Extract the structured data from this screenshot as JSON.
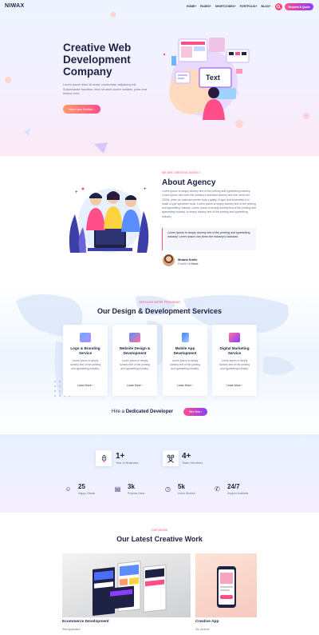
{
  "header": {
    "logo": "NIWAX",
    "nav": [
      "HOME+",
      "PAGES+",
      "SHORTCODES+",
      "PORTFOLIO+",
      "BLOG+"
    ],
    "quote_label": "Request A Quote"
  },
  "hero": {
    "title": "Creative Web Development Company",
    "text": "Lorem ipsum dolor sit amet, consectetur adipiscing elit. Suspendisse faucibus, risus sit amet auctor sodales, justo erat tempor eros.",
    "button": "View Case Studies"
  },
  "about": {
    "subtitle": "WE ARE CREATIVE AGENCY",
    "title": "About Agency",
    "text": "Lorem Ipsum is simply dummy text of the printing and typesetting industry. Lorem Ipsum has been the industry's standard dummy text ever since the 1500s, when an unknown printer took a galley of type and scrambled it to make a type specimen book. Lorem Ipsum is simply dummy text of the printing and typesetting industry. Lorem Ipsum is simply dummy text of the printing and typesetting industry. is simply dummy text of the printing and typesetting industry.",
    "quote": "Lorem Ipsum is simply dummy text of the printing and typesetting industry. Lorem Ipsum has been the industry's standard.",
    "author_name": "Moana Smile",
    "author_role_prefix": "Founder of",
    "author_company": "Niwax"
  },
  "services": {
    "subtitle": "SERVICES WE'RE PROVIDING",
    "title": "Our Design & Development Services",
    "cards": [
      {
        "title": "Logo & Branding Service",
        "text": "Lorem ipsum is simply dummy text of the printing and typesetting industry.",
        "link": "Learn More"
      },
      {
        "title": "Website Design & Development",
        "text": "Lorem ipsum is simply dummy text of the printing and typesetting industry.",
        "link": "Learn More"
      },
      {
        "title": "Mobile App Development",
        "text": "Lorem ipsum is simply dummy text of the printing and typesetting industry.",
        "link": "Learn More"
      },
      {
        "title": "Digital Marketing Service",
        "text": "Lorem ipsum is simply dummy text of the printing and typesetting industry.",
        "link": "Learn More"
      }
    ],
    "hire_prefix": "Hire a",
    "hire_bold": "Dedicated Developer",
    "hire_button": "Hire Now"
  },
  "stats": {
    "big": [
      {
        "value": "1+",
        "label": "Year In Business",
        "icon": "rocket-icon"
      },
      {
        "value": "4+",
        "label": "Team Members",
        "icon": "team-icon"
      }
    ],
    "small": [
      {
        "value": "25",
        "label": "Happy Clients",
        "icon": "clients-icon"
      },
      {
        "value": "3k",
        "label": "Projects Done",
        "icon": "projects-icon"
      },
      {
        "value": "5k",
        "label": "Hours Worked",
        "icon": "hours-icon"
      },
      {
        "value": "24/7",
        "label": "Support Available",
        "icon": "support-icon"
      }
    ]
  },
  "work": {
    "subtitle": "OUR WORK",
    "title": "Our Latest Creative Work",
    "items": [
      {
        "title": "Ecommerce Development",
        "category": "Web Application"
      },
      {
        "title": "Creative App",
        "category": "iOs, Android"
      }
    ]
  }
}
